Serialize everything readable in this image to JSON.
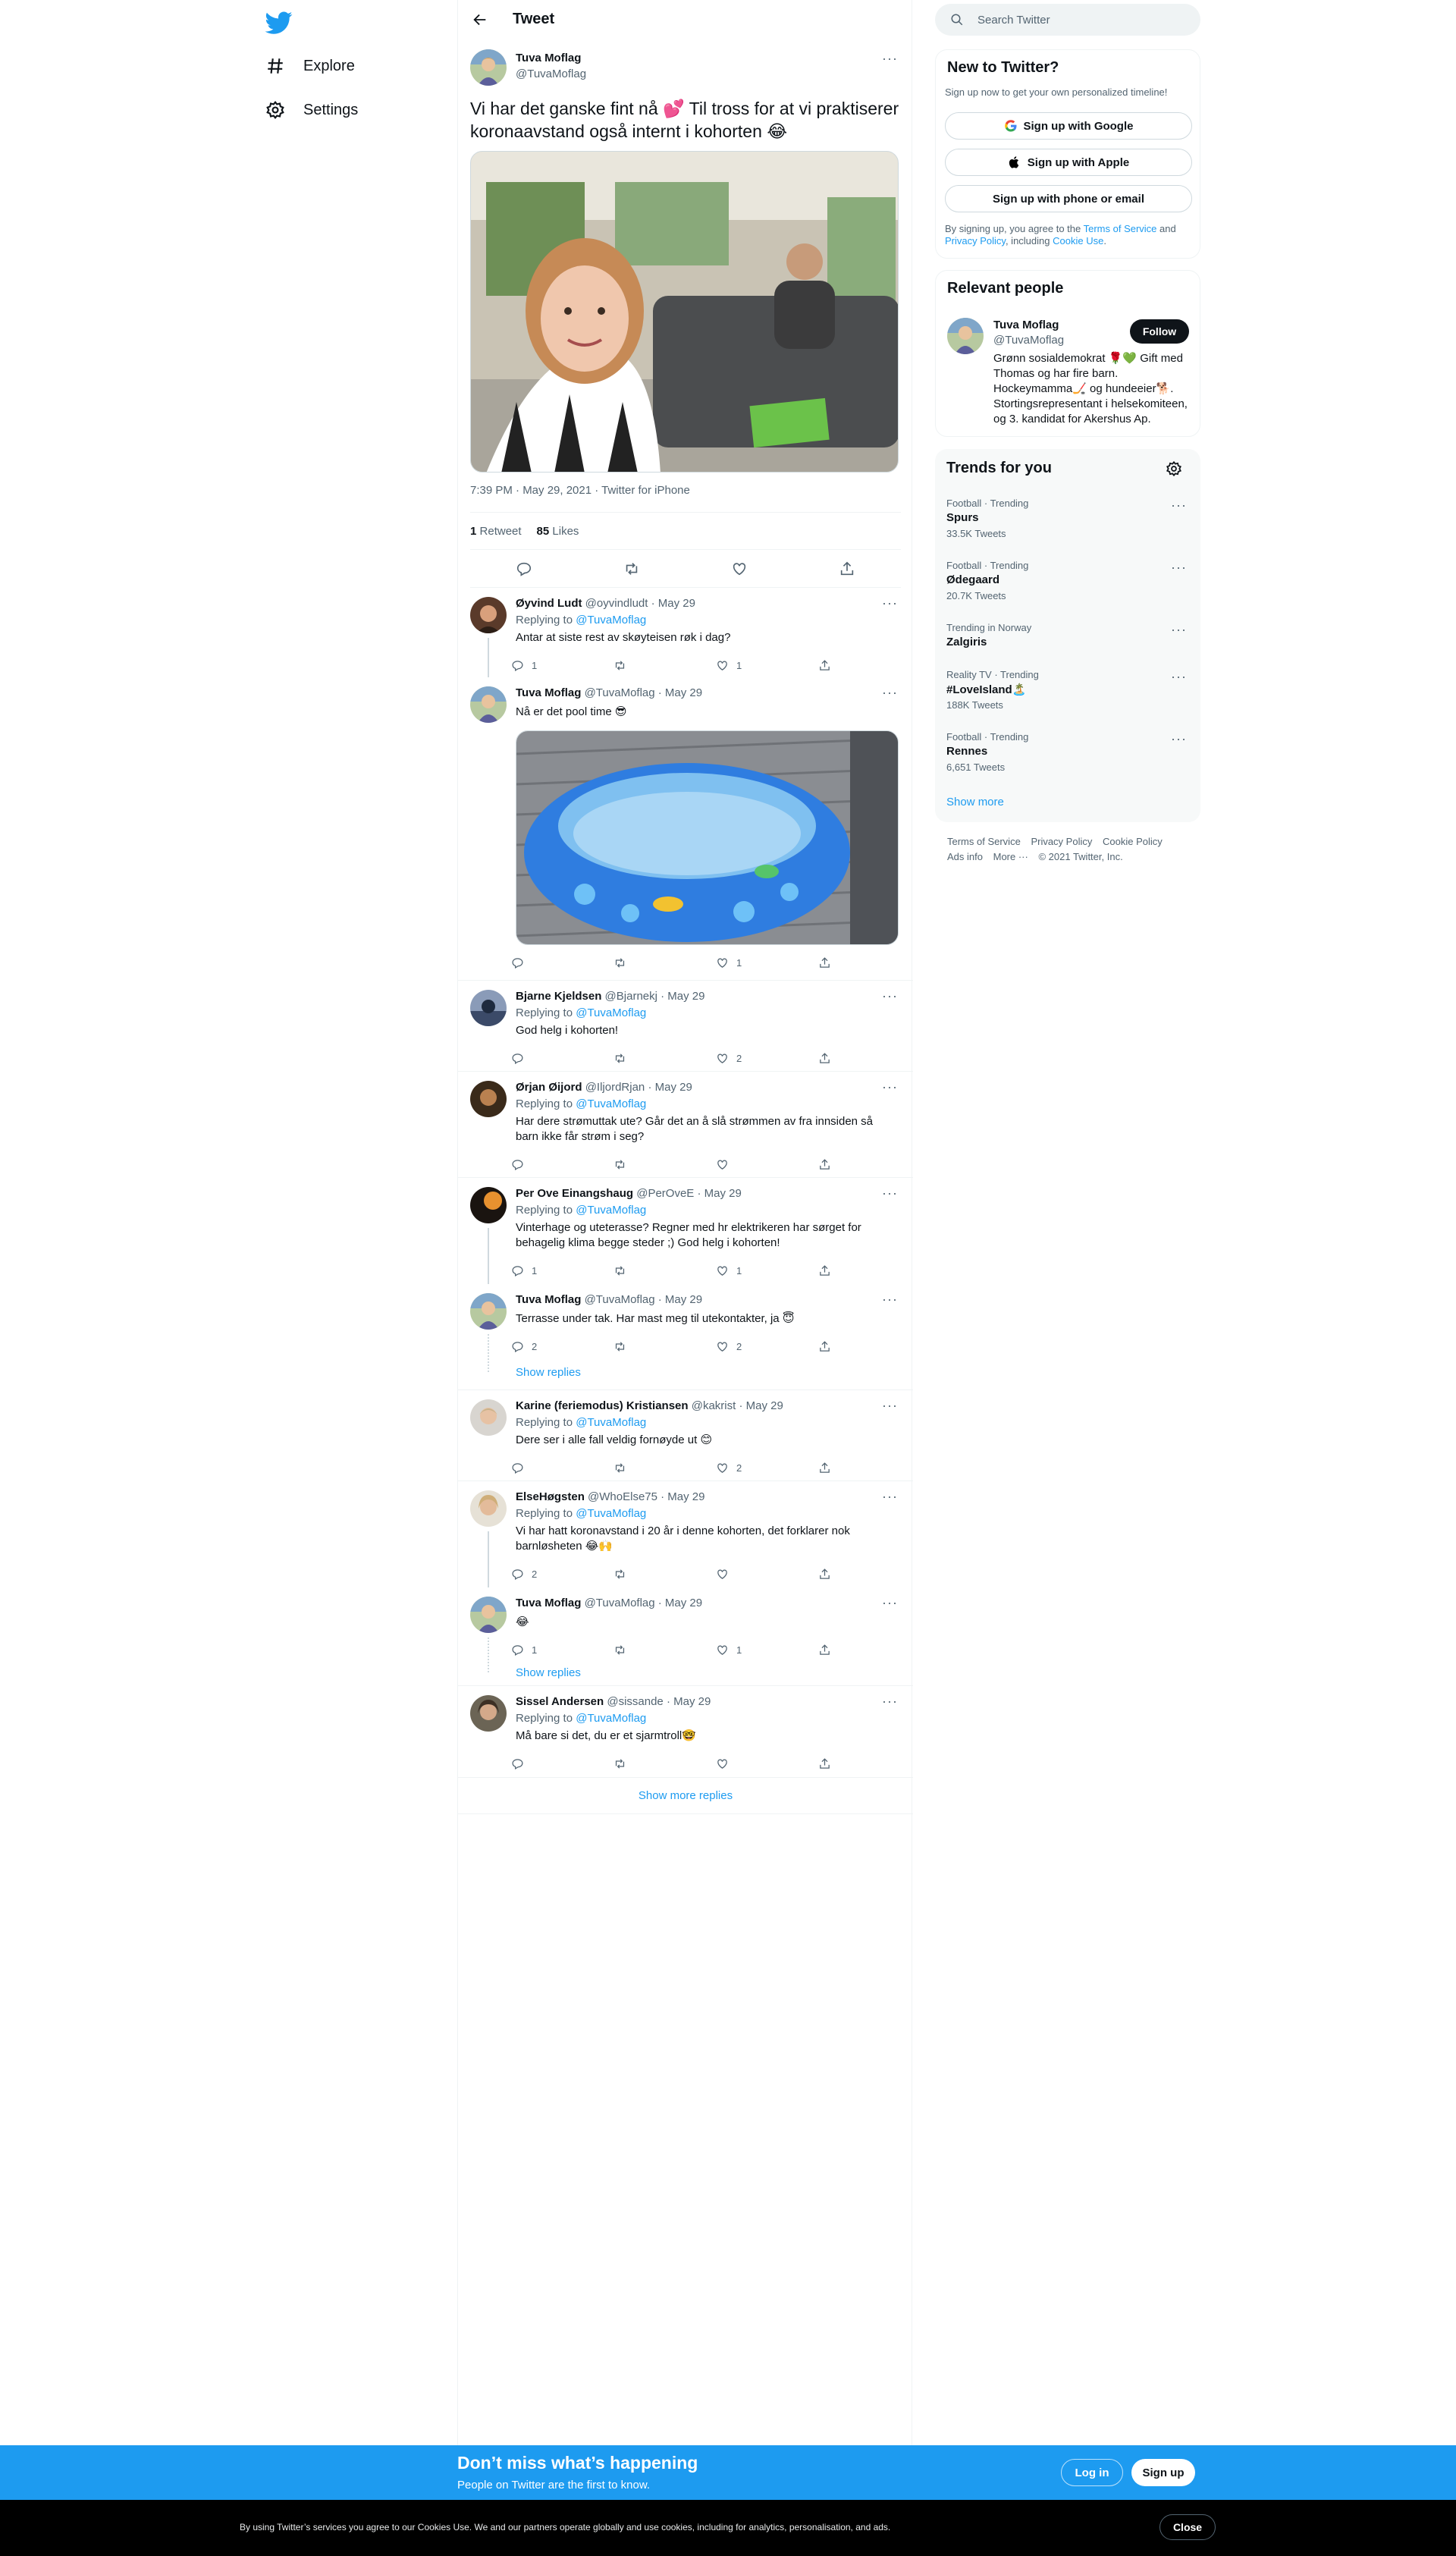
{
  "nav": {
    "items": [
      {
        "label": "Explore",
        "icon": "hashtag-icon"
      },
      {
        "label": "Settings",
        "icon": "gear-icon"
      }
    ]
  },
  "header": {
    "title": "Tweet"
  },
  "main_tweet": {
    "name": "Tuva Moflag",
    "handle": "@TuvaMoflag",
    "text": "Vi har det ganske fint nå 💕 Til tross for at vi praktiserer koronaavstand også internt i kohorten 😂",
    "meta": "7:39 PM · May 29, 2021 · Twitter for iPhone",
    "retweets": "1",
    "retweets_label": "Retweet",
    "likes": "85",
    "likes_label": "Likes"
  },
  "replies": [
    {
      "name": "Øyvind Ludt",
      "handle": "@oyvindludt · May 29",
      "replying_prefix": "Replying to ",
      "replying_to": "@TuvaMoflag",
      "text": "Antar at siste rest av skøyteisen røk i dag?",
      "reply_count": "1",
      "retweet_count": "",
      "like_count": "1"
    },
    {
      "name": "Tuva Moflag",
      "handle": "@TuvaMoflag · May 29",
      "text": "Nå er det pool time 😎",
      "reply_count": "",
      "retweet_count": "",
      "like_count": "1"
    },
    {
      "name": "Bjarne Kjeldsen",
      "handle": "@Bjarnekj · May 29",
      "replying_prefix": "Replying to ",
      "replying_to": "@TuvaMoflag",
      "text": "God helg i kohorten!",
      "reply_count": "",
      "retweet_count": "",
      "like_count": "2"
    },
    {
      "name": "Ørjan Øijord",
      "handle": "@IljordRjan · May 29",
      "replying_prefix": "Replying to ",
      "replying_to": "@TuvaMoflag",
      "text": "Har dere strømuttak ute? Går det an å slå strømmen av fra innsiden så barn ikke får strøm i seg?",
      "reply_count": "",
      "retweet_count": "",
      "like_count": ""
    },
    {
      "name": "Per Ove Einangshaug",
      "handle": "@PerOveE · May 29",
      "replying_prefix": "Replying to ",
      "replying_to": "@TuvaMoflag",
      "text": "Vinterhage og uteterasse? Regner med hr elektrikeren har sørget for behagelig klima begge steder ;) God helg i kohorten!",
      "reply_count": "1",
      "retweet_count": "",
      "like_count": "1"
    },
    {
      "name": "Tuva Moflag",
      "handle": "@TuvaMoflag · May 29",
      "text": "Terrasse under tak. Har mast meg til utekontakter, ja 😇",
      "reply_count": "2",
      "retweet_count": "",
      "like_count": "2",
      "show_replies": "Show replies"
    },
    {
      "name": "Karine (feriemodus) Kristiansen",
      "handle": "@kakrist · May 29",
      "replying_prefix": "Replying to ",
      "replying_to": "@TuvaMoflag",
      "text": "Dere ser i alle fall veldig fornøyde ut 😊",
      "reply_count": "",
      "retweet_count": "",
      "like_count": "2"
    },
    {
      "name": "ElseHøgsten",
      "handle": "@WhoElse75 · May 29",
      "replying_prefix": "Replying to ",
      "replying_to": "@TuvaMoflag",
      "text": "Vi har hatt koronavstand i 20 år i denne kohorten, det forklarer nok barnløsheten 😂🙌",
      "reply_count": "2",
      "retweet_count": "",
      "like_count": ""
    },
    {
      "name": "Tuva Moflag",
      "handle": "@TuvaMoflag · May 29",
      "text": "😂",
      "reply_count": "1",
      "retweet_count": "",
      "like_count": "1",
      "show_replies": "Show replies"
    },
    {
      "name": "Sissel Andersen",
      "handle": "@sissande · May 29",
      "replying_prefix": "Replying to ",
      "replying_to": "@TuvaMoflag",
      "text": "Må bare si det, du er et sjarmtroll🤓",
      "reply_count": "",
      "retweet_count": "",
      "like_count": ""
    }
  ],
  "show_more_replies": "Show more replies",
  "search": {
    "placeholder": "Search Twitter"
  },
  "new_to_twitter": {
    "title": "New to Twitter?",
    "subtitle": "Sign up now to get your own personalized timeline!",
    "google": "Sign up with Google",
    "apple": "Sign up with Apple",
    "phone": "Sign up with phone or email",
    "legal_1": "By signing up, you agree to the ",
    "tos": "Terms of Service",
    "legal_2": " and ",
    "privacy": "Privacy Policy",
    "legal_3": ", including ",
    "cookie": "Cookie Use",
    "legal_4": "."
  },
  "relevant": {
    "title": "Relevant people",
    "name": "Tuva Moflag",
    "handle": "@TuvaMoflag",
    "follow": "Follow",
    "bio": "Grønn sosialdemokrat 🌹💚 Gift med Thomas og har fire barn. Hockeymamma🏒 og hundeeier🐕. Stortingsrepresentant i helsekomiteen, og 3. kandidat for Akershus Ap."
  },
  "trends": {
    "title": "Trends for you",
    "items": [
      {
        "meta": "Football · Trending",
        "name": "Spurs",
        "count": "33.5K Tweets"
      },
      {
        "meta": "Football · Trending",
        "name": "Ødegaard",
        "count": "20.7K Tweets"
      },
      {
        "meta": "Trending in Norway",
        "name": "Zalgiris",
        "count": ""
      },
      {
        "meta": "Reality TV · Trending",
        "name": "#LoveIsland🏝️",
        "count": "188K Tweets"
      },
      {
        "meta": "Football · Trending",
        "name": "Rennes",
        "count": "6,651 Tweets"
      }
    ],
    "show_more": "Show more"
  },
  "footer": {
    "tos": "Terms of Service",
    "privacy": "Privacy Policy",
    "cookie": "Cookie Policy",
    "ads": "Ads info",
    "more": "More ···",
    "copyright": "© 2021 Twitter, Inc."
  },
  "bottom_bar": {
    "title": "Don’t miss what’s happening",
    "subtitle": "People on Twitter are the first to know.",
    "login": "Log in",
    "signup": "Sign up"
  },
  "cookie_bar": {
    "text": "By using Twitter’s services you agree to our Cookies Use. We and our partners operate globally and use cookies, including for analytics, personalisation, and ads.",
    "close": "Close"
  },
  "colors": {
    "accent": "#1d9bf0",
    "text": "#0f1419",
    "muted": "#536471",
    "border": "#eff3f4"
  }
}
